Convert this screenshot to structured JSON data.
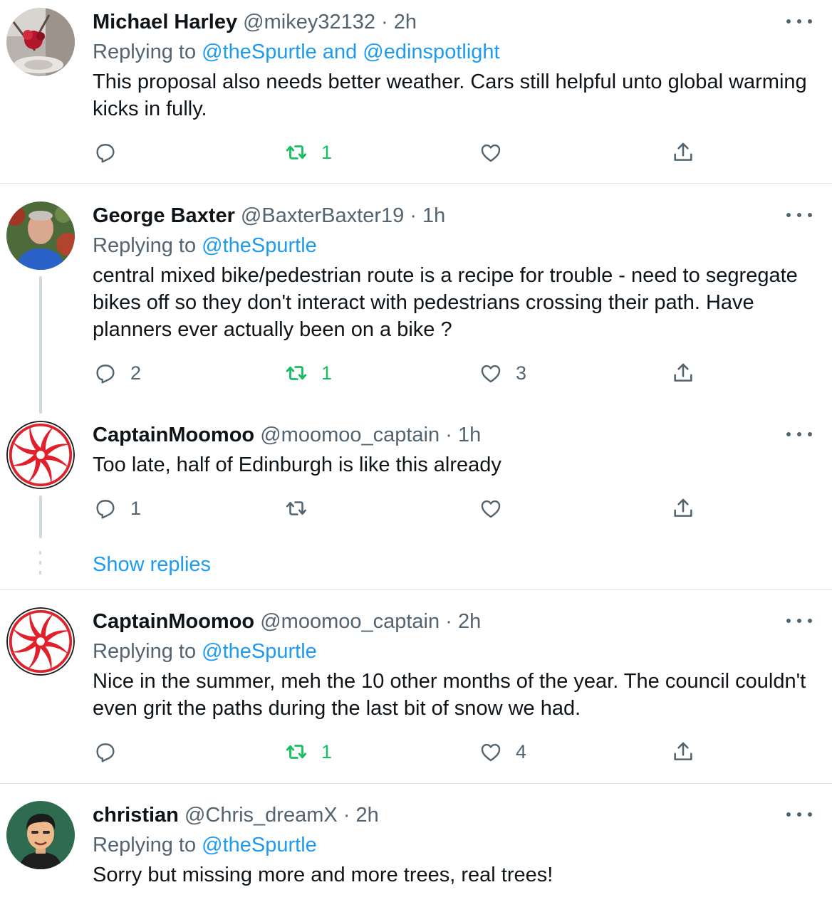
{
  "tweets": [
    {
      "name": "Michael Harley",
      "handle": "@mikey32132",
      "time": "2h",
      "replying_prefix": "Replying to",
      "replying_to": "@theSpurtle and @edinspotlight",
      "text": "This proposal also needs better weather. Cars still helpful unto global warming kicks in fully.",
      "replies": "",
      "retweets": "1",
      "likes": "",
      "avatar_icon": "flowers-photo-avatar"
    },
    {
      "name": "George Baxter",
      "handle": "@BaxterBaxter19",
      "time": "1h",
      "replying_prefix": "Replying to",
      "replying_to": "@theSpurtle",
      "text": "central mixed bike/pedestrian route is a recipe for trouble - need to segregate bikes off so they don't interact with pedestrians crossing their path. Have planners ever actually been on a bike ?",
      "replies": "2",
      "retweets": "1",
      "likes": "3",
      "avatar_icon": "man-photo-avatar"
    },
    {
      "name": "CaptainMoomoo",
      "handle": "@moomoo_captain",
      "time": "1h",
      "text": "Too late, half of Edinburgh is like this already",
      "replies": "1",
      "retweets": "",
      "likes": "",
      "avatar_icon": "peppermint-avatar"
    },
    {
      "name": "CaptainMoomoo",
      "handle": "@moomoo_captain",
      "time": "2h",
      "replying_prefix": "Replying to",
      "replying_to": "@theSpurtle",
      "text": "Nice in the summer, meh the 10 other months of the year.  The council couldn't even grit the paths during the last bit of snow we had.",
      "replies": "",
      "retweets": "1",
      "likes": "4",
      "avatar_icon": "peppermint-avatar"
    },
    {
      "name": "christian",
      "handle": "@Chris_dreamX",
      "time": "2h",
      "replying_prefix": "Replying to",
      "replying_to": "@theSpurtle",
      "text": "Sorry but missing more and more trees, real trees!",
      "avatar_icon": "cartoon-man-avatar"
    }
  ],
  "show_replies": "Show replies",
  "separator": "·",
  "colors": {
    "accent": "#1d9bf0",
    "retweet_green": "#17bf63",
    "muted": "#536471",
    "divider": "#e1e4e7"
  }
}
